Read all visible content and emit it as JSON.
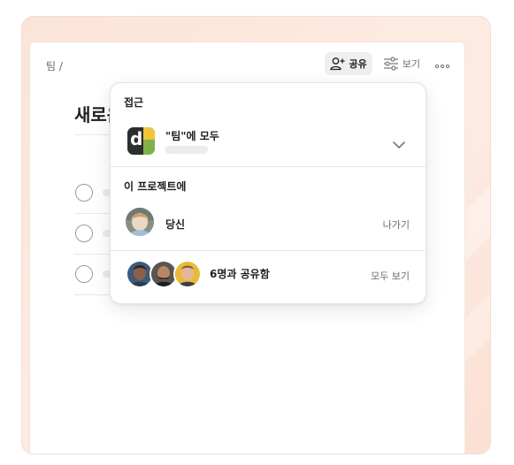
{
  "breadcrumb": "팀 /",
  "toolbar": {
    "share_label": "공유",
    "view_label": "보기",
    "icons": [
      "add-person-icon",
      "sliders-icon",
      "more-horizontal-icon"
    ]
  },
  "page": {
    "title_visible": "새로운"
  },
  "popover": {
    "access_title": "접근",
    "team_access_label": "\"팀\"에 모두",
    "project_section_title": "이 프로젝트에",
    "you_label": "당신",
    "leave_label": "나가기",
    "shared_label": "6명과 공유함",
    "view_all_label": "모두 보기"
  },
  "colors": {
    "accent_bg": "#fbe3d8",
    "share_button_bg": "#f1efee",
    "team_logo_green": "#25623f",
    "team_logo_yellow": "#f2c33a"
  }
}
